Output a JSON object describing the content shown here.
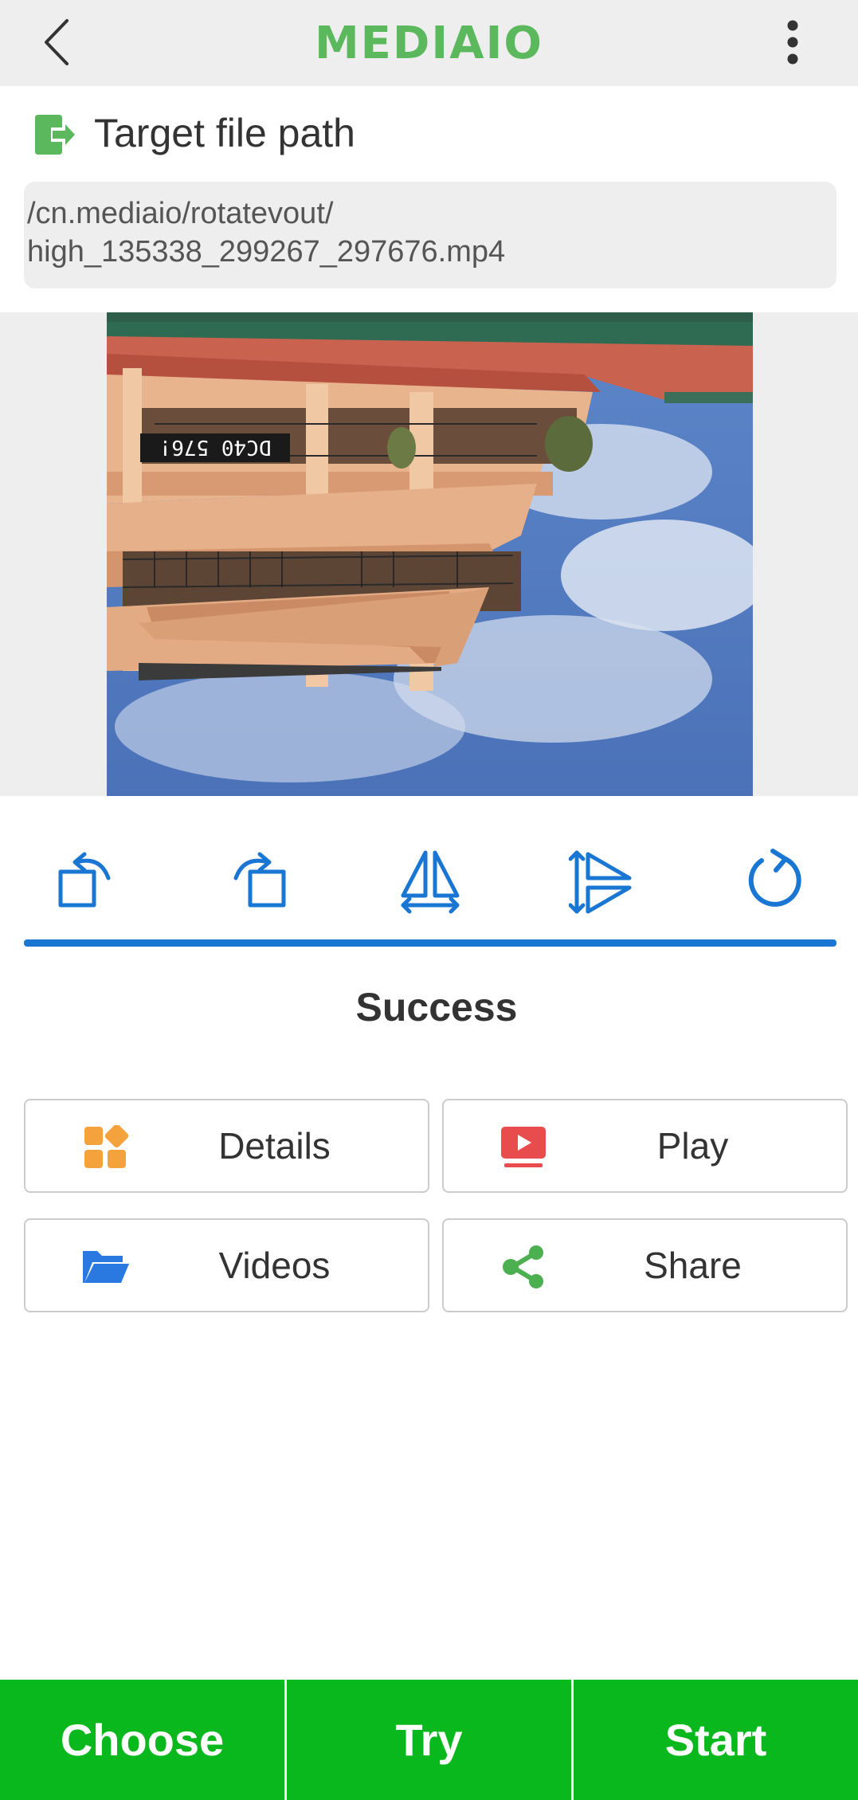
{
  "app": {
    "logo": "MEDIAIO"
  },
  "icons": {
    "back": "back-arrow-icon",
    "menu": "more-vert-icon",
    "path": "export-file-icon"
  },
  "colors": {
    "accent_green": "#5cb85c",
    "tool_blue": "#1976d2",
    "button_green": "#08b81c"
  },
  "target": {
    "title": "Target file path",
    "path_line1": "/cn.mediaio/rotatevout/",
    "path_line2": "high_135338_299267_297676.mp4"
  },
  "preview": {
    "overlay_text": "DC40 576!"
  },
  "tools": [
    "rotate-left-icon",
    "rotate-right-icon",
    "flip-horizontal-icon",
    "flip-vertical-icon",
    "reset-icon"
  ],
  "progress": {
    "percent": 100
  },
  "status": "Success",
  "actions": {
    "details": "Details",
    "play": "Play",
    "videos": "Videos",
    "share": "Share"
  },
  "bottom": {
    "choose": "Choose",
    "try": "Try",
    "start": "Start"
  }
}
